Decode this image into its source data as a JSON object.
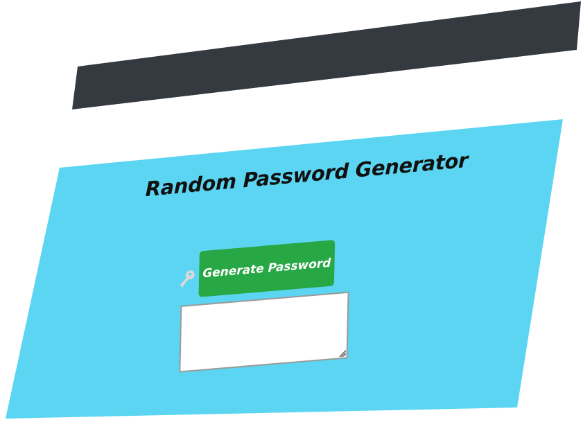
{
  "page": {
    "title": "Random Password Generator"
  },
  "generator": {
    "button_label": "Generate Password",
    "output_value": "",
    "output_placeholder": ""
  },
  "icons": {
    "key": "key-icon",
    "resize": "resize-grip-icon"
  },
  "colors": {
    "navbar": "#343a40",
    "background": "#5bd5f2",
    "button": "#28a745",
    "button_text": "#ffffff",
    "title_text": "#111111"
  }
}
